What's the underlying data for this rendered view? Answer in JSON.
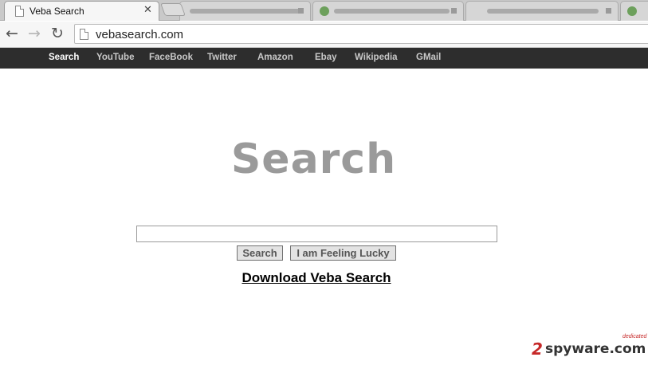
{
  "browser": {
    "tab_title": "Veba Search",
    "tab_close": "✕",
    "url": "vebasearch.com",
    "nav": {
      "back": "←",
      "forward": "→",
      "reload": "↻"
    }
  },
  "topnav": {
    "items": [
      {
        "label": "Search",
        "active": true
      },
      {
        "label": "YouTube"
      },
      {
        "label": "FaceBook"
      },
      {
        "label": "Twitter"
      },
      {
        "label": "Amazon"
      },
      {
        "label": "Ebay"
      },
      {
        "label": "Wikipedia"
      },
      {
        "label": "GMail"
      }
    ]
  },
  "main": {
    "logo": "Search",
    "search_value": "",
    "search_button": "Search",
    "lucky_button": "I am Feeling Lucky",
    "download_link": "Download Veba Search"
  },
  "watermark": {
    "number": "2",
    "text": "spyware.com",
    "tagline": "dedicated"
  },
  "colors": {
    "topnav_bg": "#2d2d2d",
    "logo_gray": "#9a9a9a",
    "watermark_red": "#c62828"
  }
}
